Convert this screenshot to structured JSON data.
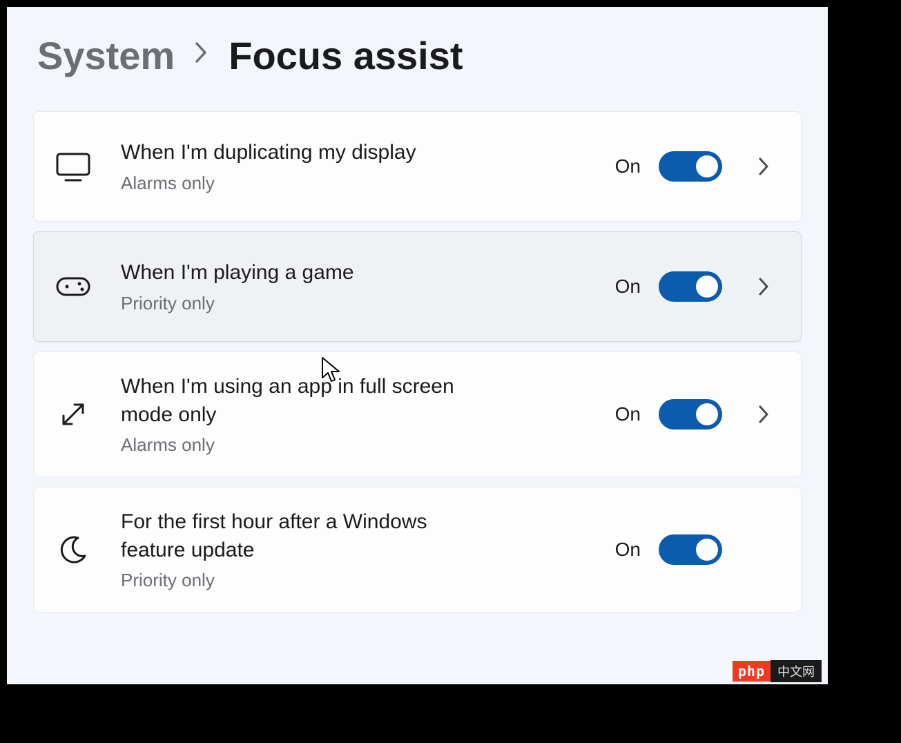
{
  "breadcrumb": {
    "parent": "System",
    "current": "Focus assist"
  },
  "rules": [
    {
      "icon": "monitor-icon",
      "title": "When I'm duplicating my display",
      "subtitle": "Alarms only",
      "state_label": "On",
      "expandable": true,
      "hovered": false
    },
    {
      "icon": "gamepad-icon",
      "title": "When I'm playing a game",
      "subtitle": "Priority only",
      "state_label": "On",
      "expandable": true,
      "hovered": true
    },
    {
      "icon": "fullscreen-icon",
      "title": "When I'm using an app in full screen mode only",
      "subtitle": "Alarms only",
      "state_label": "On",
      "expandable": true,
      "hovered": false
    },
    {
      "icon": "moon-icon",
      "title": "For the first hour after a Windows feature update",
      "subtitle": "Priority only",
      "state_label": "On",
      "expandable": false,
      "hovered": false
    }
  ],
  "colors": {
    "accent": "#0b5cad",
    "page_bg": "#f3f6fb",
    "card_bg": "#fdfdfd",
    "card_hover_bg": "#eff1f5",
    "text_primary": "#1b1b1b",
    "text_secondary": "#6b6e74"
  },
  "watermark": {
    "left": "php",
    "right": "中文网"
  }
}
